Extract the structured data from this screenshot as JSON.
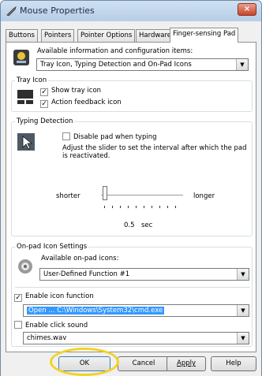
{
  "window": {
    "title": "Mouse Properties",
    "close_glyph": "×"
  },
  "tabs": [
    "Buttons",
    "Pointers",
    "Pointer Options",
    "Hardware",
    "Finger-sensing Pad"
  ],
  "panel": {
    "info_label": "Available information and configuration items:",
    "info_select": "Tray Icon, Typing Detection and On-Pad Icons",
    "tray_icon": {
      "title": "Tray Icon",
      "show_tray_icon": "Show tray icon",
      "action_feedback": "Action feedback icon"
    },
    "typing": {
      "title": "Typing Detection",
      "disable_pad": "Disable pad when typing",
      "desc": "Adjust the slider to set the interval after which the pad is reactivated.",
      "shorter": "shorter",
      "longer": "longer",
      "value": "0.5",
      "unit": "sec"
    },
    "onpad": {
      "title": "On-pad Icon Settings",
      "available_label": "Available on-pad icons:",
      "available_select": "User-Defined Function #1",
      "enable_icon": "Enable icon function",
      "function_value": "Open ... C:\\Windows\\System32\\cmd.exe",
      "enable_sound": "Enable click sound",
      "sound_value": "chimes.wav"
    }
  },
  "buttons": {
    "ok": "OK",
    "cancel": "Cancel",
    "apply": "Apply",
    "help": "Help"
  },
  "colors": {
    "highlight_ring": "#f2d224",
    "selection": "#3399ff"
  }
}
